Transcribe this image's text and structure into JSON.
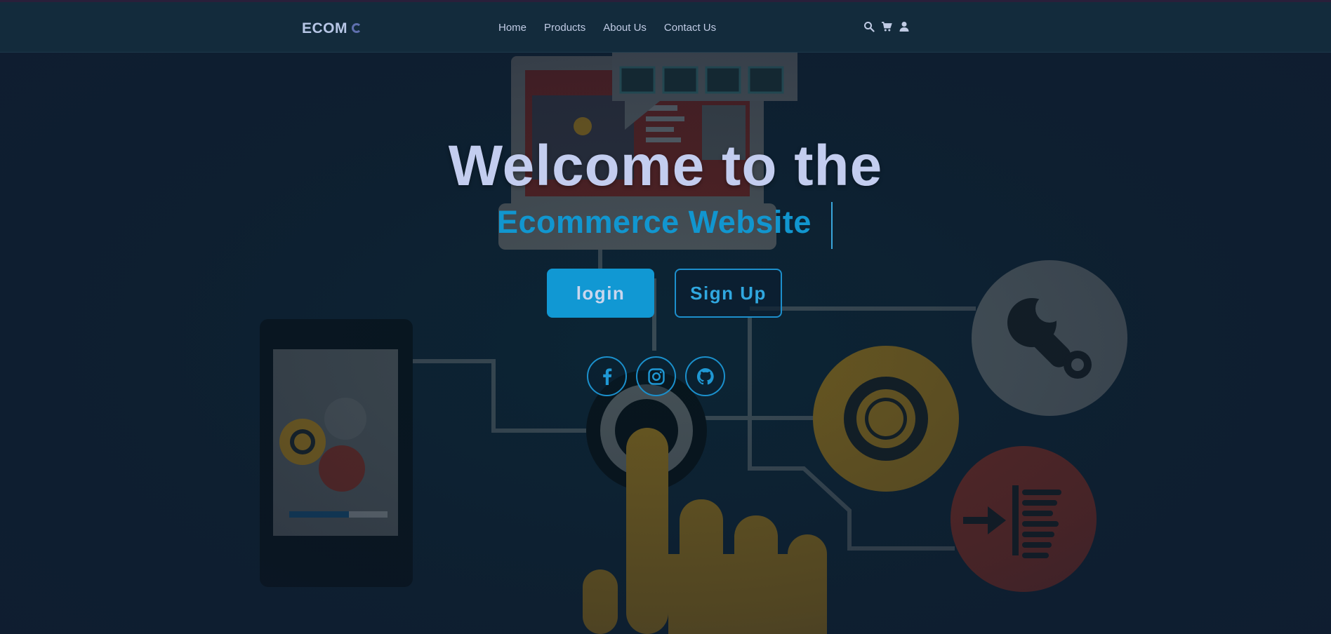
{
  "navbar": {
    "logo_text": "ECOM",
    "links": [
      "Home",
      "Products",
      "About Us",
      "Contact Us"
    ],
    "icons": [
      "search-icon",
      "cart-icon",
      "user-icon"
    ]
  },
  "hero": {
    "title": "Welcome to the",
    "subtitle": "Ecommerce Website",
    "login_label": "login",
    "signup_label": "Sign Up"
  },
  "socials": [
    "facebook-icon",
    "instagram-icon",
    "github-icon"
  ],
  "colors": {
    "accent": "#1198d3",
    "title_text": "#c3cdef",
    "background": "#0d2030"
  }
}
